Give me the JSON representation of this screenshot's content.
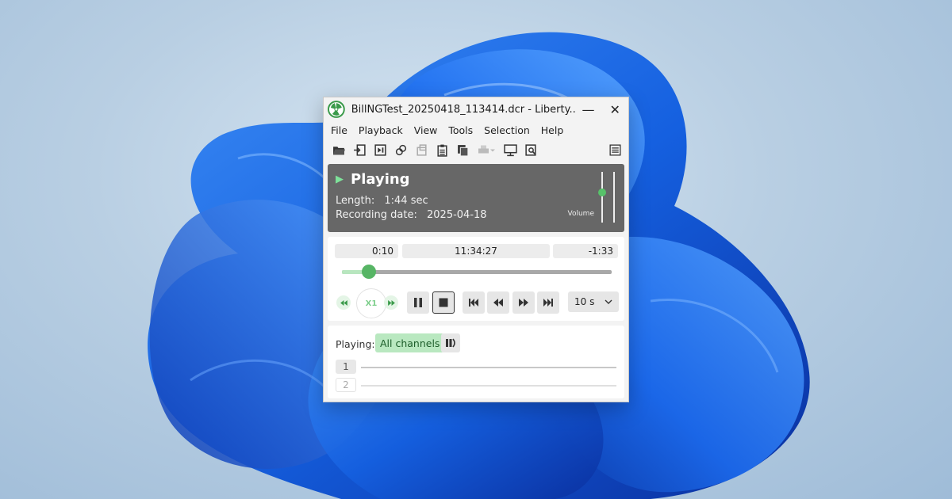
{
  "window": {
    "title": "BillNGTest_20250418_113414.dcr - Liberty...",
    "minimize_glyph": "—",
    "close_glyph": "✕"
  },
  "menu": [
    "File",
    "Playback",
    "View",
    "Tools",
    "Selection",
    "Help"
  ],
  "toolbar_icons": [
    "open-folder-icon",
    "import-icon",
    "export-icon",
    "link-icon",
    "properties-icon",
    "clipboard-icon",
    "copy-icon",
    "print-icon",
    "screen-icon",
    "preview-icon",
    "menu-lines-icon"
  ],
  "status": {
    "state": "Playing",
    "length_label": "Length:",
    "length_value": "1:44 sec",
    "date_label": "Recording date:",
    "date_value": "2025-04-18",
    "volume_label": "Volume",
    "volume_level": 0.6
  },
  "transport": {
    "elapsed": "0:10",
    "clock_time": "11:34:27",
    "remaining": "-1:33",
    "progress": 0.1,
    "speed": "X1",
    "skip_interval": "10 s"
  },
  "channels": {
    "playing_label": "Playing:",
    "all_channels_label": "All channels",
    "list": [
      {
        "number": "1",
        "active": true
      },
      {
        "number": "2",
        "active": false
      }
    ]
  },
  "colors": {
    "accent_green": "#57b565",
    "status_panel": "#676767"
  }
}
